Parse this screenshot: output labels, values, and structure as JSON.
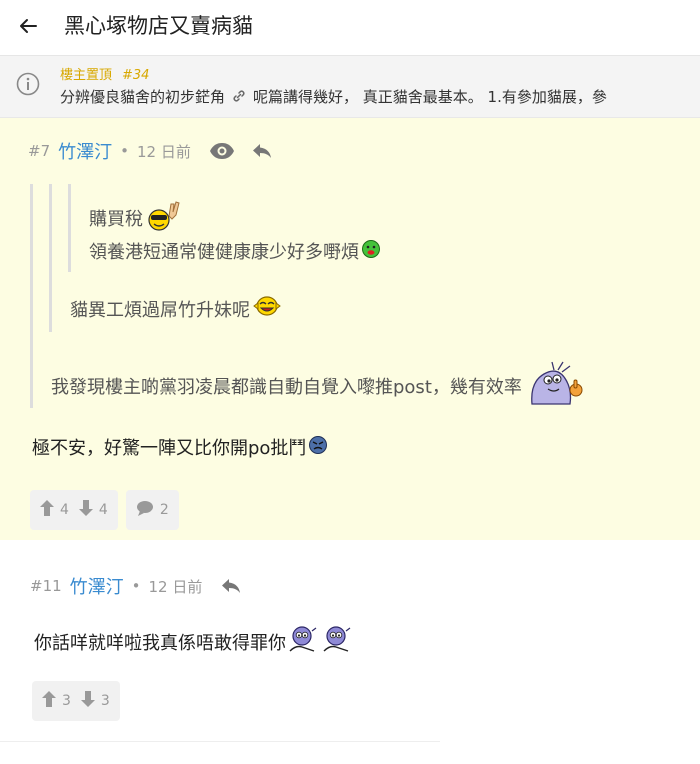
{
  "header": {
    "title": "黑心塚物店又賣病貓"
  },
  "pinned": {
    "tag": "樓主置頂",
    "floor": "#34",
    "text_before_link": "分辨優良貓舍的初步鋩角",
    "text_after_link": "呢篇講得幾好， 真正貓舍最基本。 1.有參加貓展，參"
  },
  "post7": {
    "floor": "#7",
    "author": "竹澤汀",
    "time": "12 日前",
    "quote_inner_1": "購買稅",
    "quote_inner_2": "領養港短通常健健康康少好多嘢煩",
    "quote_middle": "貓異工煩過屌竹升妹呢",
    "quote_outer": "我發現樓主啲黨羽凌晨都識自動自覺入嚟推post，幾有效率",
    "body": "極不安，好驚一陣又比你開po批鬥",
    "up": "4",
    "down": "4",
    "comments": "2"
  },
  "post11": {
    "floor": "#11",
    "author": "竹澤汀",
    "time": "12 日前",
    "body": "你話咩就咩啦我真係唔敢得罪你",
    "up": "3",
    "down": "3"
  },
  "colors": {
    "author": "#3a8bd0",
    "pin_tag": "#d8a800",
    "quote_bg": "#fdfde2"
  },
  "icons": [
    "back-arrow-icon",
    "info-icon",
    "link-icon",
    "eye-icon",
    "reply-icon",
    "thumb-up-icon",
    "thumb-down-icon",
    "comment-icon"
  ]
}
